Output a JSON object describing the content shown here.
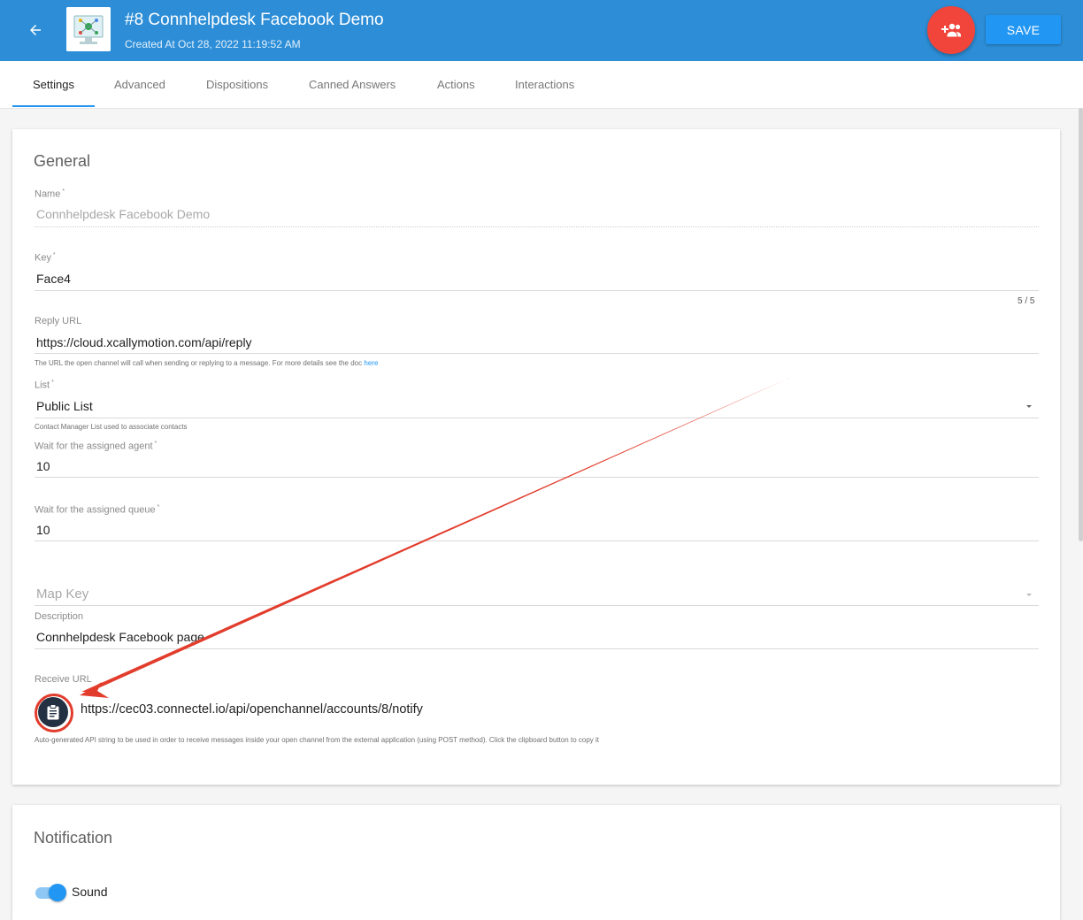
{
  "header": {
    "title": "#8 Connhelpdesk Facebook Demo",
    "created": "Created At Oct 28, 2022 11:19:52 AM",
    "save_label": "SAVE",
    "back_icon": "arrow-left-icon",
    "add_agent_icon": "group-add-icon",
    "colors": {
      "bar": "#2d8ed7",
      "fab": "#f1443a",
      "save": "#2196f3"
    }
  },
  "tabs": [
    {
      "label": "Settings",
      "active": true
    },
    {
      "label": "Advanced"
    },
    {
      "label": "Dispositions"
    },
    {
      "label": "Canned Answers"
    },
    {
      "label": "Actions"
    },
    {
      "label": "Interactions"
    }
  ],
  "general": {
    "title": "General",
    "name": {
      "label": "Name",
      "value": "Connhelpdesk Facebook Demo"
    },
    "key": {
      "label": "Key",
      "value": "Face4",
      "counter": "5 / 5"
    },
    "reply_url": {
      "label": "Reply URL",
      "value": "https://cloud.xcallymotion.com/api/reply",
      "hint": "The URL the open channel will call when sending or replying to a message. For more details see the doc",
      "hint_link": "here"
    },
    "list": {
      "label": "List",
      "value": "Public List",
      "hint": "Contact Manager List used to associate contacts"
    },
    "wait_agent": {
      "label": "Wait for the assigned agent",
      "value": "10"
    },
    "wait_queue": {
      "label": "Wait for the assigned queue",
      "value": "10"
    },
    "map_key": {
      "placeholder": "Map Key"
    },
    "description": {
      "label": "Description",
      "value": "Connhelpdesk Facebook page"
    },
    "receive_url": {
      "label": "Receive URL",
      "value": "https://cec03.connectel.io/api/openchannel/accounts/8/notify",
      "hint": "Auto-generated API string to be used in order to receive messages inside your open channel from the external application (using POST method). Click the clipboard button to copy it",
      "clipboard_icon": "clipboard-icon"
    },
    "required_mark": "*"
  },
  "notification": {
    "title": "Notification",
    "sound": {
      "label": "Sound",
      "enabled": true
    }
  },
  "annotation": {
    "color": "#e23c2c"
  }
}
